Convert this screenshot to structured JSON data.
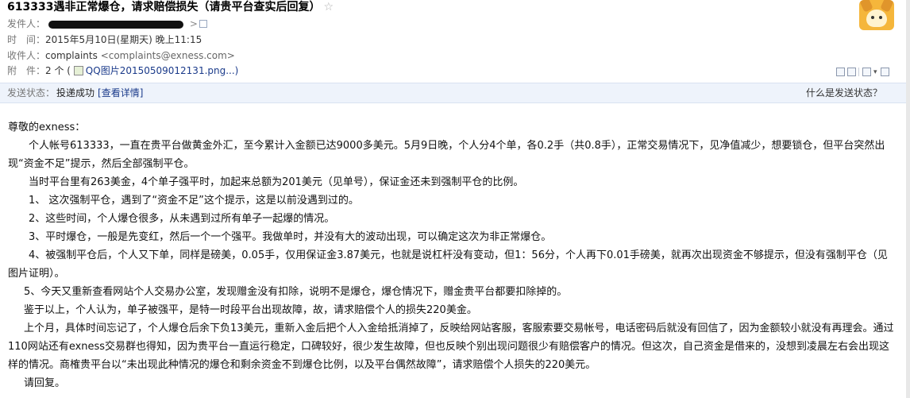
{
  "email": {
    "subject": "613333遇非正常爆仓，请求赔偿损失（请贵平台查实后回复）",
    "star": "☆",
    "from_label": "发件人：",
    "time_label": "时　间：",
    "time_value": "2015年5月10日(星期天) 晚上11:15",
    "to_label": "收件人：",
    "to_name": "complaints",
    "to_email": "<complaints@exness.com>",
    "attach_label": "附　件：",
    "attach_count": "2 个 (",
    "attach_name": "QQ图片20150509012131.png...)",
    "arrow": ">"
  },
  "status_bar": {
    "label": "发送状态：",
    "value": "投递成功",
    "link": "[查看详情]",
    "help": "什么是发送状态？"
  },
  "body": {
    "greeting": "尊敬的exness：",
    "p1": "个人帐号613333，一直在贵平台做黄金外汇，至今累计入金额已达9000多美元。5月9日晚，个人分4个单，各0.2手（共0.8手），正常交易情况下，见净值减少，想要锁仓，但平台突然出现“资金不足”提示，然后全部强制平仓。",
    "p2": "当时平台里有263美金，4个单子强平时，加起来总额为201美元（见单号），保证金还未到强制平仓的比例。",
    "p3": "1、  这次强制平仓，遇到了“资金不足”这个提示，这是以前没遇到过的。",
    "p4": "2、这些时间，个人爆仓很多，从未遇到过所有单子一起爆的情况。",
    "p5": "3、平时爆仓，一般是先变红，然后一个一个强平。我做单时，并没有大的波动出现，可以确定这次为非正常爆仓。",
    "p6": "4、被强制平仓后，个人又下单，同样是磅美，0.05手，仅用保证金3.87美元，也就是说杠杆没有变动，但1：56分，个人再下0.01手磅美，就再次出现资金不够提示，但没有强制平仓（见图片证明）。",
    "p7": "5、今天又重新查看网站个人交易办公室，发现赠金没有扣除，说明不是爆仓，爆仓情况下，赠金贵平台都要扣除掉的。",
    "p8": "鉴于以上，个人认为，单子被强平，是特一时段平台出现故障，故，请求赔偿个人的损失220美金。",
    "p9": "上个月，具体时间忘记了，个人爆仓后余下负13美元，重新入金后把个人入金给抵消掉了，反映给网站客服，客服索要交易帐号，电话密码后就没有回信了，因为金额较小就没有再理会。通过110网站还有exness交易群也得知，因为贵平台一直运行稳定，口碑较好，很少发生故障，但也反映个别出现问题很少有赔偿客户的情况。但这次，自己资金是借来的，没想到凌晨左右会出现这样的情况。商榷贵平台以“未出现此种情况的爆仓和剩余资金不到爆仓比例，以及平台偶然故障”，请求赔偿个人损失的220美元。",
    "p10": "请回复。"
  }
}
